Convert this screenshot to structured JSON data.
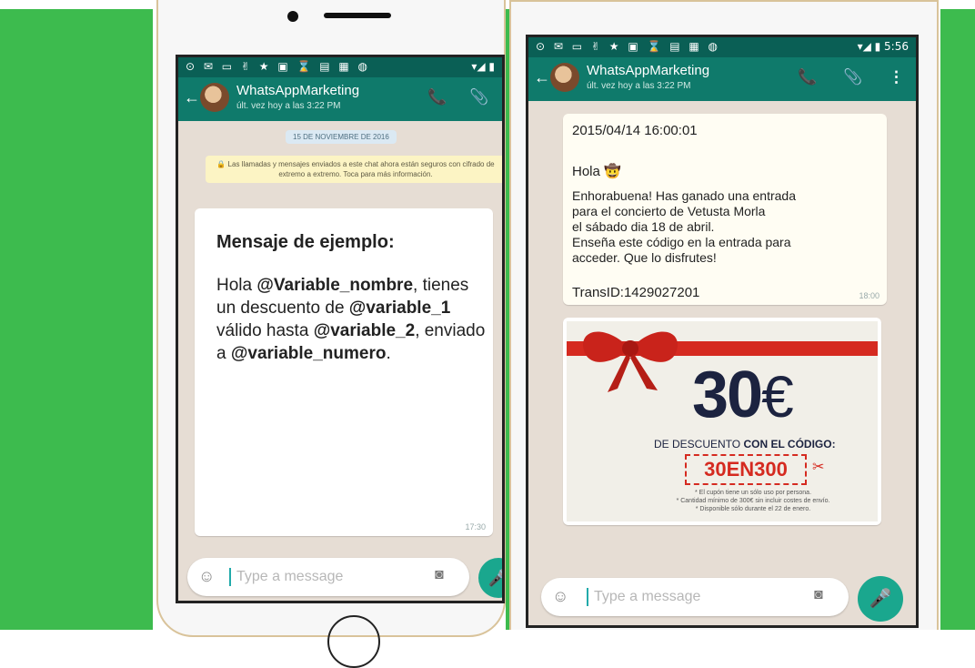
{
  "colors": {
    "brand_green": "#3dbb4e",
    "header_teal": "#0f7a6b",
    "status_teal": "#0a5f55",
    "mic": "#1aa78e",
    "coupon_red": "#d52a20"
  },
  "left_phone": {
    "status_icons": "⊙ ✉ ▭ ✌ ★ ▣ ⌛ ▤ ▦ ◍",
    "status_right": "▾◢ ▮",
    "contact_name": "WhatsAppMarketing",
    "last_seen": "últ. vez hoy a las 3:22 PM",
    "back_icon": "arrow-left-icon",
    "call_icon": "phone-icon",
    "attach_icon": "paperclip-icon",
    "date_pill": "15 DE NOVIEMBRE DE 2016",
    "notice": "🔒 Las llamadas y mensajes enviados a este chat ahora están seguros con cifrado de extremo a extremo. Toca para más información.",
    "message": {
      "heading": "Mensaje de ejemplo:",
      "p1": "Hola ",
      "var_nombre": "@Variable_nombre",
      "p2": ", tienes un descuento de ",
      "var_1": "@variable_1",
      "p3": " válido hasta ",
      "var_2": "@variable_2",
      "p4": ", enviado a ",
      "var_numero": "@variable_numero",
      "p5": ".",
      "time": "17:30"
    },
    "input_placeholder": "Type a message",
    "smiley": "☺",
    "camera": "◙"
  },
  "right_phone": {
    "status_icons": "⊙ ✉ ▭ ✌ ★ ▣ ⌛ ▤ ▦ ◍",
    "status_right": "▾◢ ▮ 5:56",
    "contact_name": "WhatsAppMarketing",
    "last_seen": "últ. vez hoy a las 3:22 PM",
    "more_icon": "⋮",
    "message": {
      "timestamp": "2015/04/14 16:00:01",
      "greeting": "Hola",
      "line1": "Enhorabuena! Has ganado una entrada",
      "line2": "para el concierto de Vetusta Morla",
      "line3": "el sábado dia 18 de abril.",
      "line4": "Enseña este código en la entrada para",
      "line5": "acceder. Que lo disfrutes!",
      "trans_id": "TransID:1429027201",
      "time": "18:00"
    },
    "coupon": {
      "amount": "30",
      "currency": "€",
      "line_a": "DE DESCUENTO ",
      "line_b": "CON EL CÓDIGO:",
      "code": "30EN300",
      "fine1": "* El cupón tiene un sólo uso por persona.",
      "fine2": "* Cantidad mínimo de 300€ sin incluir costes de envío.",
      "fine3": "* Disponible sólo durante el 22 de enero."
    },
    "input_placeholder": "Type a message",
    "smiley": "☺",
    "camera": "◙",
    "mic": "🎤"
  }
}
